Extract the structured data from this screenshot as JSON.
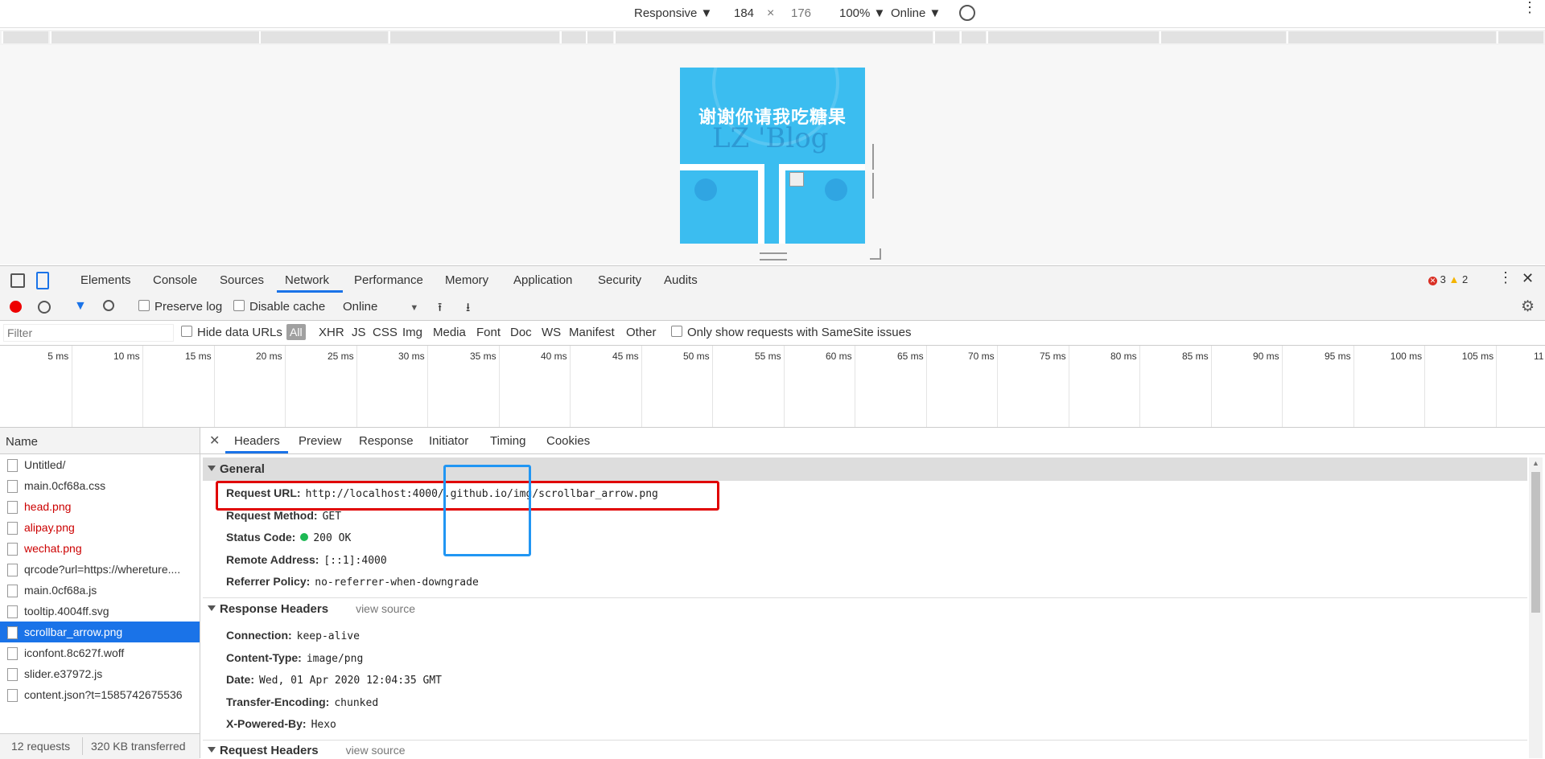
{
  "device_toolbar": {
    "device": "Responsive ▼",
    "width": "184",
    "times": "×",
    "height": "176",
    "zoom": "100% ▼",
    "throttle": "Online ▼"
  },
  "page_preview": {
    "title": "谢谢你请我吃糖果",
    "watermark": "LZ 'Blog"
  },
  "devtools_tabs": [
    "Elements",
    "Console",
    "Sources",
    "Network",
    "Performance",
    "Memory",
    "Application",
    "Security",
    "Audits"
  ],
  "active_tab": "Network",
  "status_counts": {
    "errors": "3",
    "warnings": "2"
  },
  "network_toolbar": {
    "preserve_log": "Preserve log",
    "disable_cache": "Disable cache",
    "throttling": "Online"
  },
  "filter_bar": {
    "placeholder": "Filter",
    "hide_data_urls": "Hide data URLs",
    "types": [
      "All",
      "XHR",
      "JS",
      "CSS",
      "Img",
      "Media",
      "Font",
      "Doc",
      "WS",
      "Manifest",
      "Other"
    ],
    "samesite": "Only show requests with SameSite issues"
  },
  "timeline_labels": [
    "5 ms",
    "10 ms",
    "15 ms",
    "20 ms",
    "25 ms",
    "30 ms",
    "35 ms",
    "40 ms",
    "45 ms",
    "50 ms",
    "55 ms",
    "60 ms",
    "65 ms",
    "70 ms",
    "75 ms",
    "80 ms",
    "85 ms",
    "90 ms",
    "95 ms",
    "100 ms",
    "105 ms",
    "11"
  ],
  "request_list": {
    "header": "Name",
    "items": [
      {
        "name": "Untitled/",
        "error": false,
        "selected": false
      },
      {
        "name": "main.0cf68a.css",
        "error": false,
        "selected": false
      },
      {
        "name": "head.png",
        "error": true,
        "selected": false
      },
      {
        "name": "alipay.png",
        "error": true,
        "selected": false
      },
      {
        "name": "wechat.png",
        "error": true,
        "selected": false
      },
      {
        "name": "qrcode?url=https://whereture....",
        "error": false,
        "selected": false
      },
      {
        "name": "main.0cf68a.js",
        "error": false,
        "selected": false
      },
      {
        "name": "tooltip.4004ff.svg",
        "error": false,
        "selected": false
      },
      {
        "name": "scrollbar_arrow.png",
        "error": false,
        "selected": true
      },
      {
        "name": "iconfont.8c627f.woff",
        "error": false,
        "selected": false
      },
      {
        "name": "slider.e37972.js",
        "error": false,
        "selected": false
      },
      {
        "name": "content.json?t=1585742675536",
        "error": false,
        "selected": false
      }
    ]
  },
  "summary": {
    "requests": "12 requests",
    "transferred": "320 KB transferred"
  },
  "detail_tabs": [
    "Headers",
    "Preview",
    "Response",
    "Initiator",
    "Timing",
    "Cookies"
  ],
  "general": {
    "title": "General",
    "rows": [
      {
        "k": "Request URL:",
        "v": "http://localhost:4000/.github.io/img/scrollbar_arrow.png"
      },
      {
        "k": "Request Method:",
        "v": "GET"
      },
      {
        "k": "Status Code:",
        "v": "200 OK"
      },
      {
        "k": "Remote Address:",
        "v": "[::1]:4000"
      },
      {
        "k": "Referrer Policy:",
        "v": "no-referrer-when-downgrade"
      }
    ]
  },
  "response_headers": {
    "title": "Response Headers",
    "view_source": "view source",
    "rows": [
      {
        "k": "Connection:",
        "v": "keep-alive"
      },
      {
        "k": "Content-Type:",
        "v": "image/png"
      },
      {
        "k": "Date:",
        "v": "Wed, 01 Apr 2020 12:04:35 GMT"
      },
      {
        "k": "Transfer-Encoding:",
        "v": "chunked"
      },
      {
        "k": "X-Powered-By:",
        "v": "Hexo"
      }
    ]
  },
  "request_headers": {
    "title": "Request Headers",
    "view_source": "view source"
  },
  "colors": {
    "accent": "#1a73e8",
    "error": "#cc0000",
    "highlight_red": "#e00000",
    "highlight_blue": "#2196f3",
    "status_ok": "#1db954"
  }
}
